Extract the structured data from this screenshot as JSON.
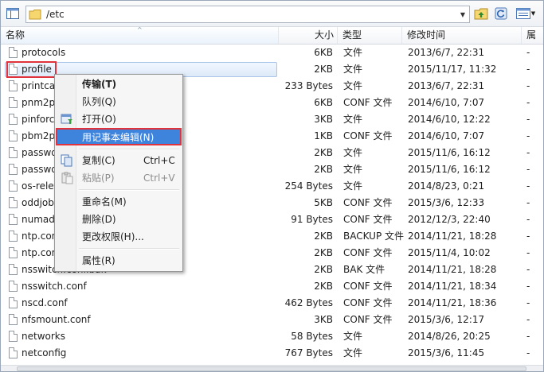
{
  "path": {
    "value": "/etc"
  },
  "columns": {
    "name": "名称",
    "size": "大小",
    "type": "类型",
    "modified": "修改时间",
    "attr": "属"
  },
  "files": [
    {
      "name": "protocols",
      "size": "6KB",
      "type": "文件",
      "modified": "2013/6/7, 22:31",
      "attr": "-"
    },
    {
      "name": "profile",
      "size": "2KB",
      "type": "文件",
      "modified": "2015/11/17, 11:32",
      "attr": "-"
    },
    {
      "name": "printcap",
      "size": "233 Bytes",
      "type": "文件",
      "modified": "2013/6/7, 22:31",
      "attr": "-"
    },
    {
      "name": "pnm2ppa.conf",
      "size": "6KB",
      "type": "CONF 文件",
      "modified": "2014/6/10, 7:07",
      "attr": "-"
    },
    {
      "name": "pinforc",
      "size": "3KB",
      "type": "文件",
      "modified": "2014/6/10, 12:22",
      "attr": "-"
    },
    {
      "name": "pbm2ppa.conf",
      "size": "1KB",
      "type": "CONF 文件",
      "modified": "2014/6/10, 7:07",
      "attr": "-"
    },
    {
      "name": "passwd",
      "size": "2KB",
      "type": "文件",
      "modified": "2015/11/6, 16:12",
      "attr": "-"
    },
    {
      "name": "passwd-",
      "size": "2KB",
      "type": "文件",
      "modified": "2015/11/6, 16:12",
      "attr": "-"
    },
    {
      "name": "os-release",
      "size": "254 Bytes",
      "type": "文件",
      "modified": "2014/8/23, 0:21",
      "attr": "-"
    },
    {
      "name": "oddjobd.conf",
      "size": "5KB",
      "type": "CONF 文件",
      "modified": "2015/3/6, 12:33",
      "attr": "-"
    },
    {
      "name": "numad.conf",
      "size": "91 Bytes",
      "type": "CONF 文件",
      "modified": "2012/12/3, 22:40",
      "attr": "-"
    },
    {
      "name": "ntp.conf.backup",
      "size": "2KB",
      "type": "BACKUP 文件",
      "modified": "2014/11/21, 18:28",
      "attr": "-"
    },
    {
      "name": "ntp.conf",
      "size": "2KB",
      "type": "CONF 文件",
      "modified": "2015/11/4, 10:02",
      "attr": "-"
    },
    {
      "name": "nsswitch.conf.bak",
      "size": "2KB",
      "type": "BAK 文件",
      "modified": "2014/11/21, 18:28",
      "attr": "-"
    },
    {
      "name": "nsswitch.conf",
      "size": "2KB",
      "type": "CONF 文件",
      "modified": "2014/11/21, 18:34",
      "attr": "-"
    },
    {
      "name": "nscd.conf",
      "size": "462 Bytes",
      "type": "CONF 文件",
      "modified": "2014/11/21, 18:36",
      "attr": "-"
    },
    {
      "name": "nfsmount.conf",
      "size": "3KB",
      "type": "CONF 文件",
      "modified": "2015/3/6, 12:17",
      "attr": "-"
    },
    {
      "name": "networks",
      "size": "58 Bytes",
      "type": "文件",
      "modified": "2014/8/26, 20:25",
      "attr": "-"
    },
    {
      "name": "netconfig",
      "size": "767 Bytes",
      "type": "文件",
      "modified": "2015/3/6, 11:45",
      "attr": "-"
    }
  ],
  "context_menu": {
    "transfer": "传输(T)",
    "queue": "队列(Q)",
    "open": "打开(O)",
    "edit_notepad": "用记事本编辑(N)",
    "copy": "复制(C)",
    "copy_shortcut": "Ctrl+C",
    "paste": "粘贴(P)",
    "paste_shortcut": "Ctrl+V",
    "rename": "重命名(M)",
    "delete": "删除(D)",
    "permissions": "更改权限(H)...",
    "properties": "属性(R)"
  },
  "colors": {
    "highlight": "#3e84dd",
    "annotation_red": "#e0333c"
  }
}
